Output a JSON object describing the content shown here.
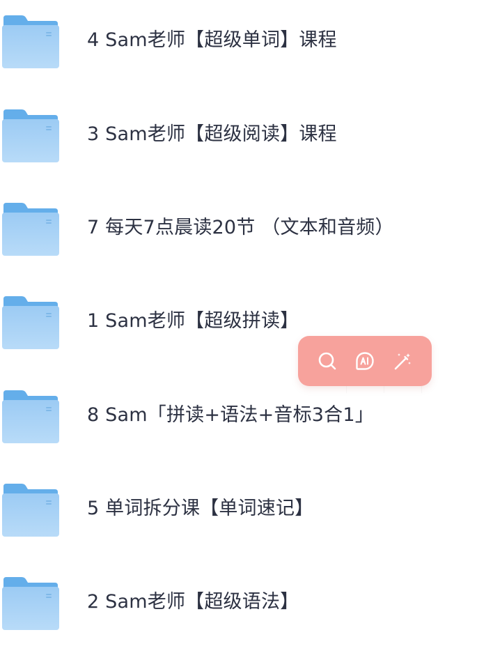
{
  "folders": [
    {
      "name": "4 Sam老师【超级单词】课程",
      "icon": "folder-icon"
    },
    {
      "name": "3 Sam老师【超级阅读】课程",
      "icon": "folder-icon"
    },
    {
      "name": "7 每天7点晨读20节 （文本和音频）",
      "icon": "folder-icon"
    },
    {
      "name": "1 Sam老师【超级拼读】",
      "icon": "folder-icon"
    },
    {
      "name": "8 Sam「拼读+语法+音标3合1」",
      "icon": "folder-icon"
    },
    {
      "name": "5 单词拆分课【单词速记】",
      "icon": "folder-icon"
    },
    {
      "name": "2 Sam老师【超级语法】",
      "icon": "folder-icon"
    }
  ],
  "toolbar": {
    "icons": [
      "search-icon",
      "ai-icon",
      "magic-wand-icon"
    ],
    "background": "#f7a29c"
  },
  "colors": {
    "text": "#2c3142",
    "folder_back": "#66b0ec",
    "folder_front": "#a9d3f7"
  }
}
